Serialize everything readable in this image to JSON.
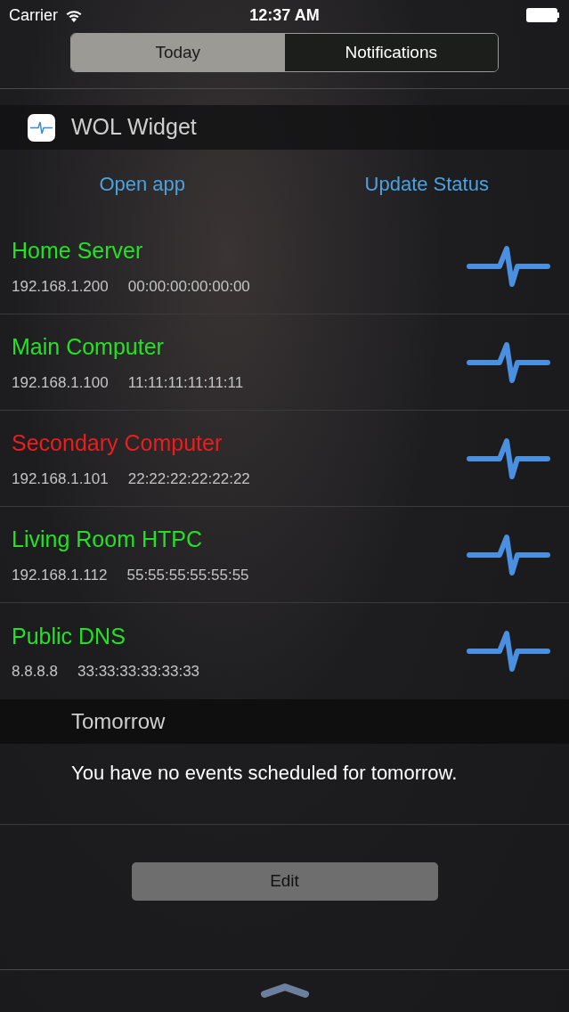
{
  "status_bar": {
    "carrier": "Carrier",
    "time": "12:37 AM"
  },
  "tabs": [
    {
      "label": "Today",
      "selected": true
    },
    {
      "label": "Notifications",
      "selected": false
    }
  ],
  "widget": {
    "title": "WOL Widget",
    "actions": [
      "Open app",
      "Update Status"
    ],
    "hosts": [
      {
        "name": "Home Server",
        "ip": "192.168.1.200",
        "mac": "00:00:00:00:00:00",
        "color": "#22e322"
      },
      {
        "name": "Main Computer",
        "ip": "192.168.1.100",
        "mac": "11:11:11:11:11:11",
        "color": "#22e322"
      },
      {
        "name": "Secondary Computer",
        "ip": "192.168.1.101",
        "mac": "22:22:22:22:22:22",
        "color": "#ee1c1c"
      },
      {
        "name": "Living Room HTPC",
        "ip": "192.168.1.112",
        "mac": "55:55:55:55:55:55",
        "color": "#22e322"
      },
      {
        "name": "Public DNS",
        "ip": "8.8.8.8",
        "mac": "33:33:33:33:33:33",
        "color": "#22e322"
      }
    ]
  },
  "tomorrow": {
    "title": "Tomorrow",
    "message": "You have no events scheduled for tomorrow."
  },
  "edit_button": "Edit"
}
